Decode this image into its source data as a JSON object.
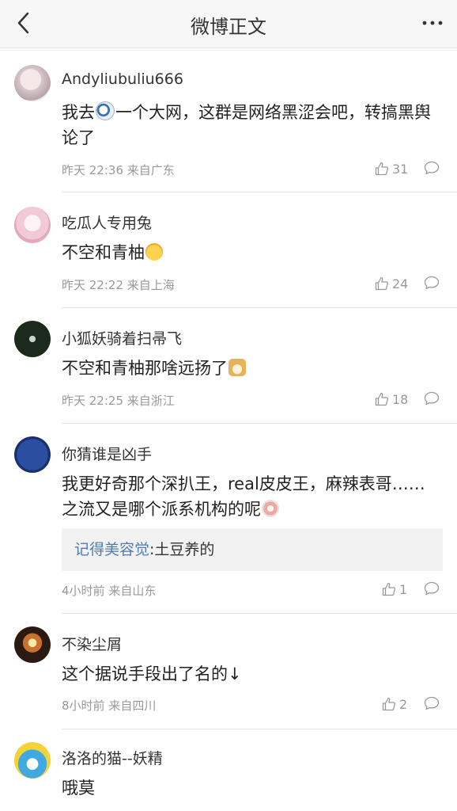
{
  "navbar": {
    "title": "微博正文"
  },
  "comments": [
    {
      "username": "Andyliubuliu666",
      "text_before": "我去",
      "text_after": "一个大网，这群是网络黑涩会吧，转搞黑舆论了",
      "time": "昨天 22:36",
      "location": "来自广东",
      "likes": "31"
    },
    {
      "username": "吃瓜人专用兔",
      "text_before": "不空和青柚",
      "text_after": "",
      "time": "昨天 22:22",
      "location": "来自上海",
      "likes": "24"
    },
    {
      "username": "小狐妖骑着扫帚飞",
      "text_before": "不空和青柚那啥远扬了",
      "text_after": "",
      "time": "昨天 22:25",
      "location": "来自浙江",
      "likes": "18"
    },
    {
      "username": "你猜谁是凶手",
      "text_before": "我更好奇那个深扒王，real皮皮王，麻辣表哥……之流又是哪个派系机构的呢",
      "text_after": "",
      "reply_author": "记得美容觉",
      "reply_text": ":土豆养的",
      "time": "4小时前",
      "location": "来自山东",
      "likes": "1"
    },
    {
      "username": "不染尘屑",
      "text_before": "这个据说手段出了名的↓",
      "text_after": "",
      "time": "8小时前",
      "location": "来自四川",
      "likes": "2"
    },
    {
      "username": "洛洛的猫--妖精",
      "text_before": "哦莫",
      "text_after": ""
    }
  ],
  "colors": {
    "link": "#507daf",
    "meta": "#999999",
    "divider": "#e5e5e5",
    "navbar": "#f7f7f7"
  },
  "icons": [
    "back-arrow-icon",
    "more-dots-icon",
    "thumbs-up-icon",
    "comment-bubble-icon"
  ]
}
